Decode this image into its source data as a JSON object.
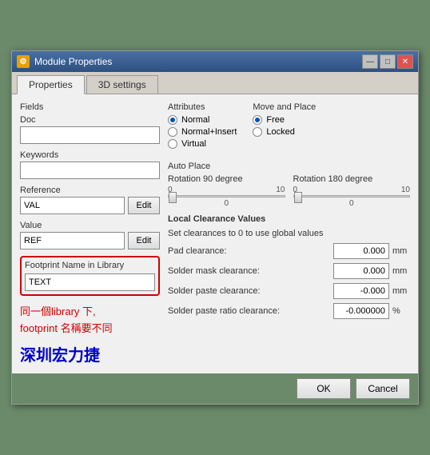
{
  "window": {
    "title": "Module Properties",
    "icon": "⚙",
    "close_btn": "✕",
    "min_btn": "—",
    "max_btn": "□"
  },
  "tabs": [
    {
      "label": "Properties",
      "active": true
    },
    {
      "label": "3D settings",
      "active": false
    }
  ],
  "fields": {
    "section_label": "Fields",
    "doc_label": "Doc",
    "doc_value": "",
    "keywords_label": "Keywords",
    "keywords_value": "",
    "reference_label": "Reference",
    "reference_value": "VAL",
    "reference_edit": "Edit",
    "value_label": "Value",
    "value_value": "REF",
    "value_edit": "Edit",
    "footprint_label": "Footprint Name in Library",
    "footprint_value": "TEXT"
  },
  "annotation": {
    "line1": "同一個library 下,",
    "line2": "footprint 名稱要不同",
    "blue_text": "深圳宏力捷"
  },
  "attributes": {
    "section_label": "Attributes",
    "options": [
      "Normal",
      "Normal+Insert",
      "Virtual"
    ],
    "selected": "Normal"
  },
  "move_and_place": {
    "section_label": "Move and Place",
    "options": [
      "Free",
      "Locked"
    ],
    "selected": "Free"
  },
  "auto_place": {
    "section_label": "Auto Place",
    "rotation_90_label": "Rotation 90 degree",
    "rotation_180_label": "Rotation 180 degree",
    "slider_min": "0",
    "slider_max": "10",
    "slider1_value": "0",
    "slider2_value": "0"
  },
  "local_clearance": {
    "section_label": "Local Clearance Values",
    "subtitle": "Set clearances to 0 to use global values",
    "rows": [
      {
        "label": "Pad clearance:",
        "value": "0.000",
        "unit": "mm"
      },
      {
        "label": "Solder mask clearance:",
        "value": "0.000",
        "unit": "mm"
      },
      {
        "label": "Solder paste clearance:",
        "value": "-0.000",
        "unit": "mm"
      },
      {
        "label": "Solder paste ratio clearance:",
        "value": "-0.000000",
        "unit": "%"
      }
    ]
  },
  "buttons": {
    "ok": "OK",
    "cancel": "Cancel"
  }
}
